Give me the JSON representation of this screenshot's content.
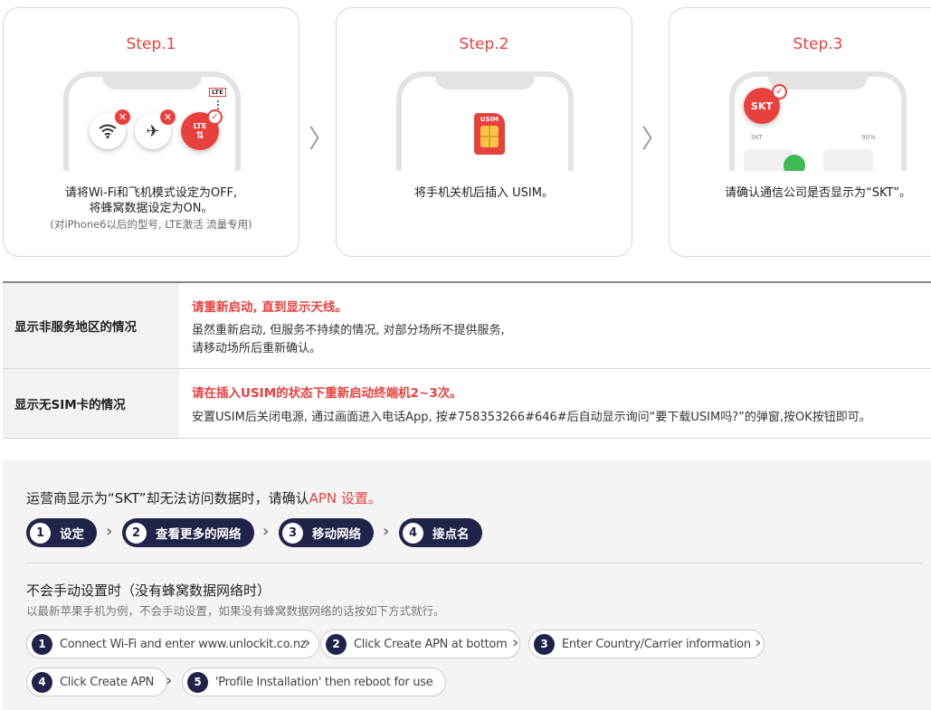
{
  "steps": [
    {
      "title": "Step.1",
      "desc_line1": "请将Wi-Fi和飞机模式设定为OFF,",
      "desc_line2": "将蜂窝数据设定为ON。",
      "note": "(对iPhone6以后的型号, LTE激活 流量专用)",
      "icons": [
        "wifi-off-icon",
        "airplane-off-icon",
        "lte-on-icon"
      ],
      "lte_label": "LTE",
      "lte_mini": "LTE"
    },
    {
      "title": "Step.2",
      "desc_line1": "将手机关机后插入 USIM。",
      "usim_label": "USIM"
    },
    {
      "title": "Step.3",
      "desc_line1": "请确认通信公司是否显示为“SKT”。",
      "carrier": "SKT",
      "status_carrier": "SKT",
      "status_battery": "90%"
    }
  ],
  "colors": {
    "accent": "#e8413d",
    "navy": "#20234a"
  },
  "trouble": [
    {
      "heading": "显示非服务地区的情况",
      "red": "请重新启动, 直到显示天线。",
      "lines": [
        "虽然重新启动, 但服务不持续的情况, 对部分场所不提供服务,",
        "请移动场所后重新确认。"
      ]
    },
    {
      "heading": "显示无SIM卡的情况",
      "red": "请在插入USIM的状态下重新启动终端机2~3次。",
      "lines": [
        "安置USIM后关闭电源, 通过画面进入电话App, 按#758353266#646#后自动显示询问“要下载USIM吗?”的弹窗,按OK按钮即可。"
      ]
    }
  ],
  "apn": {
    "title_prefix": "运营商显示为“SKT”却无法访问数据时，请确认",
    "title_highlight": "APN 设置。",
    "steps": [
      {
        "num": "1",
        "label": "设定"
      },
      {
        "num": "2",
        "label": "查看更多的网络"
      },
      {
        "num": "3",
        "label": "移动网络"
      },
      {
        "num": "4",
        "label": "接点名"
      }
    ],
    "manual_title": "不会手动设置时（没有蜂窝数据网络时）",
    "manual_sub": "以最新苹果手机为例，不会手动设置，如果没有蜂窝数据网络的话按如下方式就行。",
    "manual_steps": [
      {
        "num": "1",
        "label": "Connect Wi-Fi and enter www.unlockit.co.nz"
      },
      {
        "num": "2",
        "label": "Click Create APN at bottom"
      },
      {
        "num": "3",
        "label": "Enter Country/Carrier information"
      },
      {
        "num": "4",
        "label": "Click Create APN"
      },
      {
        "num": "5",
        "label": "'Profile Installation' then reboot for use"
      }
    ]
  }
}
